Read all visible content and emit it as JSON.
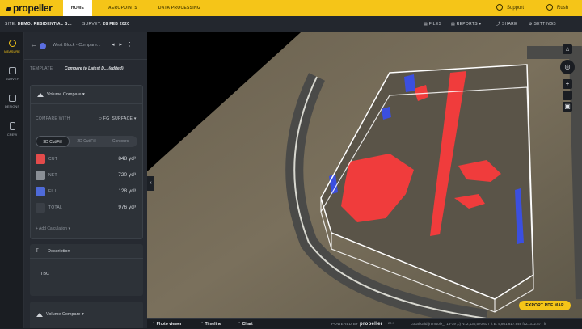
{
  "app": {
    "logo": "propeller"
  },
  "nav": {
    "tabs": [
      {
        "label": "HOME",
        "active": true
      },
      {
        "label": "AEROPOINTS",
        "active": false
      },
      {
        "label": "DATA PROCESSING",
        "active": false
      }
    ],
    "support": "Support",
    "user": "Rush"
  },
  "subbar": {
    "site_label": "SITE:",
    "site_value": "DEMO: RESIDENTIAL B...",
    "survey_label": "SURVEY:",
    "survey_value": "28 FEB 2020",
    "files": "FILES",
    "reports": "REPORTS",
    "share": "SHARE",
    "settings": "SETTINGS"
  },
  "rail": [
    {
      "label": "MEASURE",
      "icon": "measure-icon",
      "active": true
    },
    {
      "label": "SURVEY",
      "icon": "layers-icon",
      "active": false
    },
    {
      "label": "DESIGNS",
      "icon": "cube-icon",
      "active": false
    },
    {
      "label": "CREW",
      "icon": "phone-icon",
      "active": false
    }
  ],
  "panel": {
    "title": "West Block - Compare...",
    "template_label": "TEMPLATE",
    "template_value": "Compare to Latest D... (edited)",
    "card": {
      "title": "Volume Compare",
      "compare_label": "COMPARE WITH",
      "compare_value": "FG_SURFACE",
      "tabs": [
        "3D Cut/Fill",
        "2D Cut/Fill",
        "Contours"
      ],
      "rows": [
        {
          "label": "CUT",
          "value": "848 yd³",
          "color": "#e34b4b"
        },
        {
          "label": "NET",
          "value": "-720 yd³",
          "color": "#8a8f96"
        },
        {
          "label": "FILL",
          "value": "128 yd³",
          "color": "#4e6ad8"
        },
        {
          "label": "TOTAL",
          "value": "976 yd³",
          "color": "#3a3f46"
        }
      ],
      "add_calc": "+ Add Calculation ▾"
    },
    "description": {
      "title": "Description",
      "text": "TBC"
    },
    "card2": {
      "title": "Volume Compare"
    }
  },
  "map": {
    "export_label": "EXPORT PDF MAP",
    "colors": {
      "cut": "#f03c3c",
      "fill": "#3b4fe0",
      "boundary": "#ffffff"
    }
  },
  "bottombar": {
    "photo_viewer": "Photo viewer",
    "timeline": "Timeline",
    "chart": "Chart",
    "powered_by": "POWERED BY",
    "powered_logo": "propeller",
    "scale": "20 ft",
    "coords": "Local Grid (rumsole_f 18-19 ;c)  N: 2,130,570.637 ft  E: 5,861,817.946 ft  Z: 312.577 ft"
  }
}
